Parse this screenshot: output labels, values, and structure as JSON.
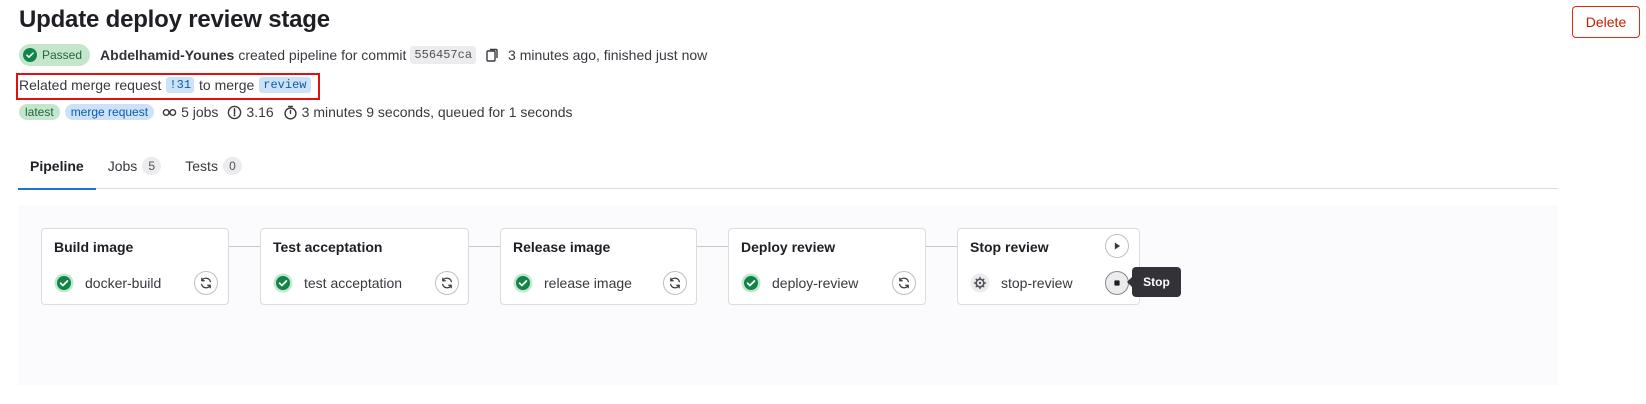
{
  "header": {
    "title": "Update deploy review stage",
    "delete_label": "Delete"
  },
  "pipeline_info": {
    "status": "Passed",
    "author": "Abdelhamid-Younes",
    "created_text": "created pipeline for commit",
    "commit_sha": "556457ca",
    "time_text": "3 minutes ago, finished just now"
  },
  "merge_request": {
    "prefix": "Related merge request",
    "id": "!31",
    "middle": "to merge",
    "branch": "review"
  },
  "meta": {
    "tag_latest": "latest",
    "tag_mr": "merge request",
    "jobs": "5 jobs",
    "score": "3.16",
    "duration": "3 minutes 9 seconds, queued for 1 seconds"
  },
  "tabs": [
    {
      "label": "Pipeline",
      "count": null
    },
    {
      "label": "Jobs",
      "count": "5"
    },
    {
      "label": "Tests",
      "count": "0"
    }
  ],
  "stages": [
    {
      "title": "Build image",
      "job": "docker-build",
      "job_status": "success",
      "action": "retry-icon"
    },
    {
      "title": "Test acceptation",
      "job": "test acceptation",
      "job_status": "success",
      "action": "retry-icon"
    },
    {
      "title": "Release image",
      "job": "release image",
      "job_status": "success",
      "action": "retry-icon"
    },
    {
      "title": "Deploy review",
      "job": "deploy-review",
      "job_status": "success",
      "action": "retry-icon"
    },
    {
      "title": "Stop review",
      "job": "stop-review",
      "job_status": "manual",
      "action": "stop-icon"
    }
  ],
  "tooltip": "Stop",
  "colors": {
    "success": "#108548",
    "link_bg": "#cbe2f9",
    "danger": "#dd2b0e",
    "tab_active": "#1f75cb"
  }
}
